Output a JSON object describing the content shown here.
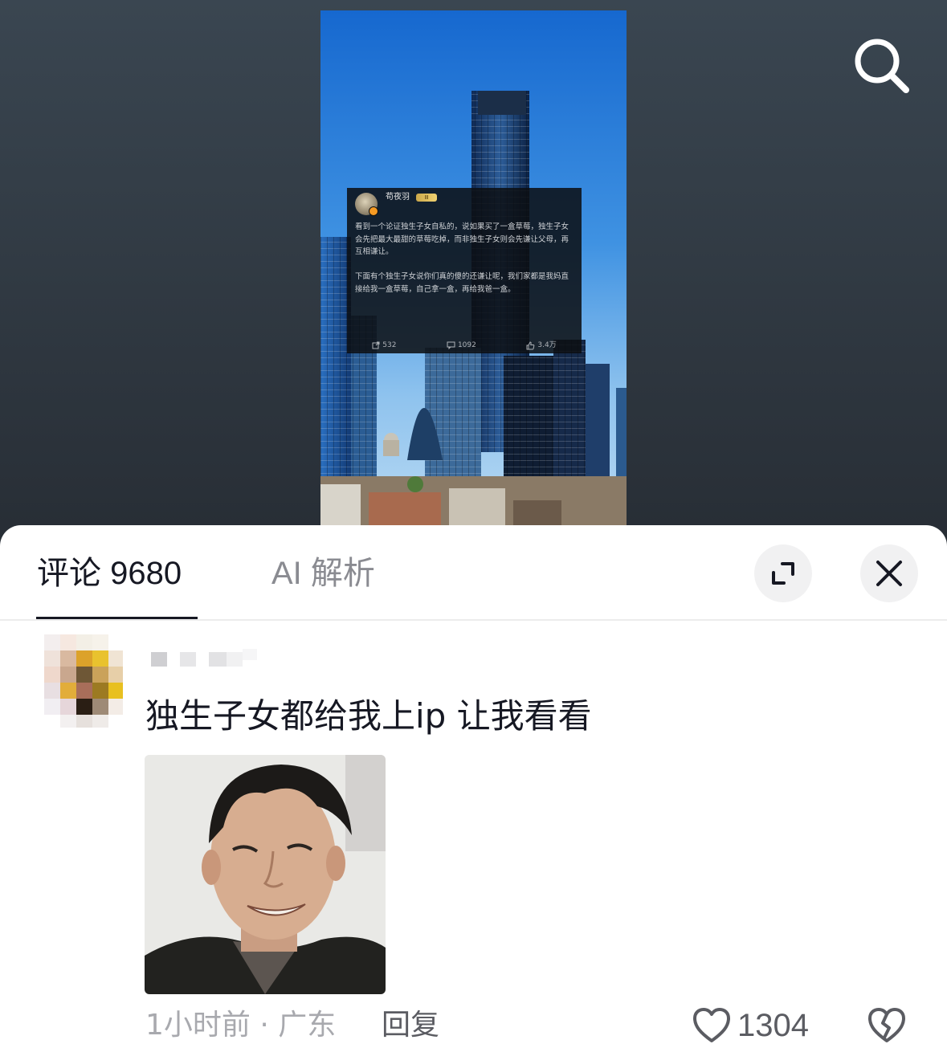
{
  "post": {
    "author": "苟夜羽",
    "level_badge": "Ⅲ",
    "paragraph1": "看到一个论证独生子女自私的，说如果买了一盒草莓，独生子女会先把最大最甜的草莓吃掉，而非独生子女则会先谦让父母，再互相谦让。",
    "paragraph2": "下面有个独生子女说你们真的傻的还谦让呢，我们家都是我妈直接给我一盒草莓，自己拿一盒，再给我爸一盒。",
    "reposts": "532",
    "comments": "1092",
    "likes": "3.4万"
  },
  "comments_panel": {
    "tab_comments": "评论 9680",
    "tab_ai": "AI 解析",
    "comment": {
      "text": "独生子女都给我上ip 让我看看",
      "meta": "1小时前 · 广东",
      "reply_label": "回复",
      "like_count": "1304"
    }
  },
  "icons": {
    "search": "search-icon",
    "expand": "expand-icon",
    "close": "close-icon",
    "like": "heart-icon",
    "dislike": "broken-heart-icon",
    "repost": "repost-icon",
    "comment": "comment-icon",
    "thumb": "thumbs-up-icon"
  }
}
